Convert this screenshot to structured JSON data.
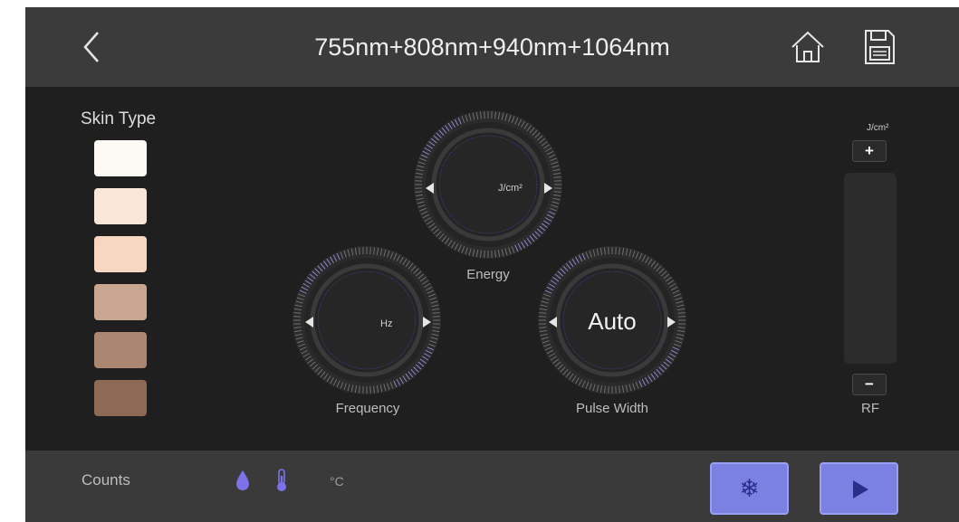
{
  "header": {
    "title": "755nm+808nm+940nm+1064nm",
    "back_icon": "chevron-left-icon",
    "home_icon": "home-icon",
    "save_icon": "floppy-disk-icon"
  },
  "skin_type": {
    "title": "Skin Type",
    "swatches": [
      "#fdf9f4",
      "#fbe7d9",
      "#f7d6c2",
      "#c9a690",
      "#ab8671",
      "#8c6a56"
    ]
  },
  "energy": {
    "unit": "J/cm²",
    "label": "Energy"
  },
  "frequency": {
    "unit": "Hz",
    "label": "Frequency"
  },
  "pulse_width": {
    "value": "Auto",
    "label": "Pulse Width"
  },
  "rf": {
    "unit": "J/cm²",
    "plus": "+",
    "minus": "−",
    "label": "RF"
  },
  "footer": {
    "counts_label": "Counts",
    "water_icon": "water-drop-icon",
    "thermometer_icon": "thermometer-icon",
    "temp_unit": "°C",
    "cool_icon": "snowflake-icon",
    "start_icon": "play-icon"
  },
  "colors": {
    "accent": "#7b80e3",
    "header_bg": "#3b3b3b",
    "panel_bg": "#1f1f1f"
  }
}
